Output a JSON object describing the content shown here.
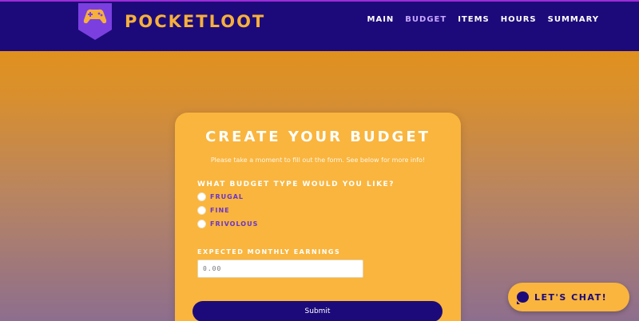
{
  "header": {
    "brand": "POCKETLOOT",
    "logo_icon": "gamepad-icon",
    "nav": [
      {
        "label": "MAIN",
        "active": false
      },
      {
        "label": "BUDGET",
        "active": true
      },
      {
        "label": "ITEMS",
        "active": false
      },
      {
        "label": "HOURS",
        "active": false
      },
      {
        "label": "SUMMARY",
        "active": false
      }
    ]
  },
  "form": {
    "title": "CREATE YOUR BUDGET",
    "subtitle": "Please take a moment to fill out the form. See below for more info!",
    "budget_question": "WHAT BUDGET TYPE WOULD YOU LIKE?",
    "budget_options": [
      "FRUGAL",
      "FINE",
      "FRIVOLOUS"
    ],
    "earnings_label": "EXPECTED MONTHLY EARNINGS",
    "earnings_placeholder": "0.00",
    "submit_label": "Submit"
  },
  "chat": {
    "label": "LET'S CHAT!",
    "icon": "chat-bubble-icon"
  },
  "colors": {
    "header_bg": "#1d0a7a",
    "accent_orange": "#f9b53e",
    "accent_purple": "#6a35c9"
  }
}
